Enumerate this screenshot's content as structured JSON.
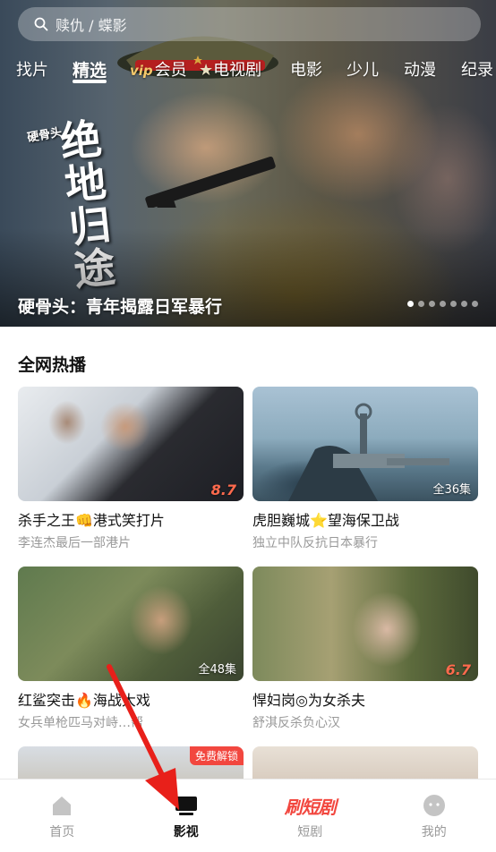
{
  "search": {
    "placeholder": "赎仇 / 蝶影"
  },
  "tabs": [
    {
      "label": "找片"
    },
    {
      "label": "精选"
    },
    {
      "label": "会员",
      "badge": "vip"
    },
    {
      "label": "电视剧"
    },
    {
      "label": "电影"
    },
    {
      "label": "少儿"
    },
    {
      "label": "动漫"
    },
    {
      "label": "纪录"
    }
  ],
  "hero": {
    "title": "硬骨头：青年揭露日军暴行",
    "logo_small": "硬骨头",
    "logo_calligraphy": "绝地归途",
    "slide_count": 7,
    "active_slide": 0
  },
  "section": {
    "title": "全网热播"
  },
  "cards": [
    {
      "title": "杀手之王👊港式笑打片",
      "subtitle": "李连杰最后一部港片",
      "score": "8.7",
      "episodes": ""
    },
    {
      "title": "虎胆巍城⭐望海保卫战",
      "subtitle": "独立中队反抗日本暴行",
      "score": "",
      "episodes": "全36集"
    },
    {
      "title": "红鲨突击🔥海战大戏",
      "subtitle": "女兵单枪匹马对峙…帮",
      "score": "",
      "episodes": "全48集"
    },
    {
      "title": "悍妇岗◎为女杀夫",
      "subtitle": "舒淇反杀负心汉",
      "score": "6.7",
      "episodes": ""
    },
    {
      "title": "",
      "subtitle": "",
      "score": "",
      "episodes": "",
      "badge": "免费解锁"
    },
    {
      "title": "",
      "subtitle": "",
      "score": "",
      "episodes": ""
    }
  ],
  "bottom_nav": [
    {
      "label": "首页",
      "icon": "home-icon"
    },
    {
      "label": "影视",
      "icon": "tv-icon",
      "active": true
    },
    {
      "label": "短剧",
      "icon": "brand-wordmark",
      "wordmark": "刷短剧"
    },
    {
      "label": "我的",
      "icon": "profile-icon"
    }
  ],
  "colors": {
    "accent": "#f2473f",
    "arrow": "#e8201a",
    "score": "#ff6a4d"
  }
}
